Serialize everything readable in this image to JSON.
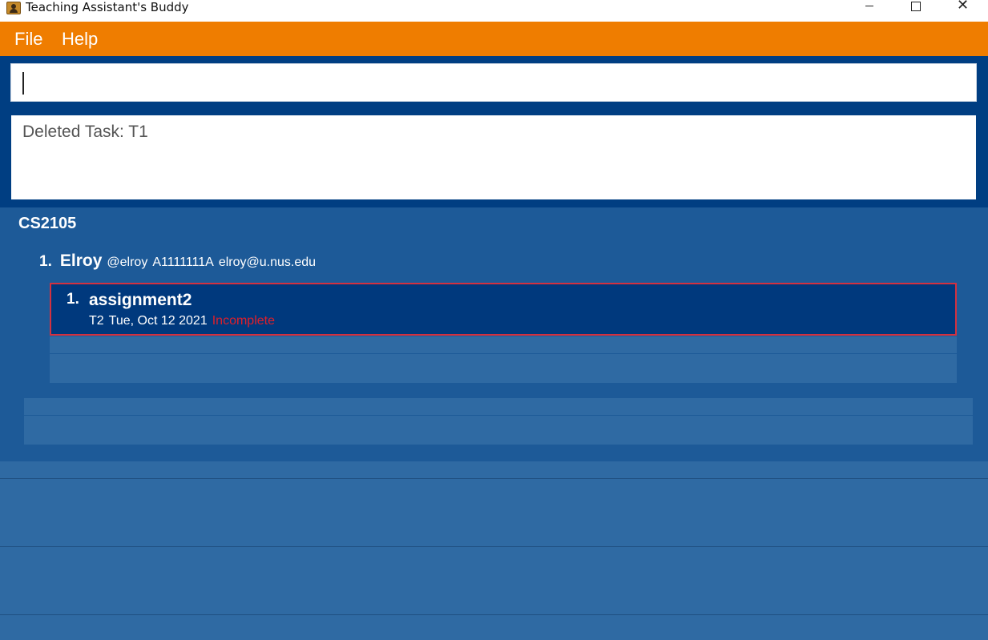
{
  "window": {
    "title": "Teaching Assistant's Buddy",
    "icon": "app-icon",
    "controls": [
      "minimize-icon",
      "maximize-icon",
      "close-icon"
    ]
  },
  "menu": {
    "file_label": "File",
    "help_label": "Help"
  },
  "command": {
    "value": ""
  },
  "result": {
    "text": "Deleted Task: T1"
  },
  "group": {
    "name": "CS2105",
    "students": [
      {
        "index": "1.",
        "name": "Elroy",
        "handle": "@elroy",
        "student_id": "A1111111A",
        "email": "elroy@u.nus.edu",
        "tasks": [
          {
            "index": "1.",
            "name": "assignment2",
            "id": "T2",
            "date": "Tue, Oct 12 2021",
            "status": "Incomplete"
          }
        ]
      }
    ]
  },
  "colors": {
    "menu_bar": "#ef7d00",
    "command_area": "#003e82",
    "group_area": "#1d5a98",
    "list_background": "#2f6aa3",
    "selected_task": "#00397d",
    "selected_border": "#d4313f",
    "status_incomplete": "#e01f2a"
  }
}
